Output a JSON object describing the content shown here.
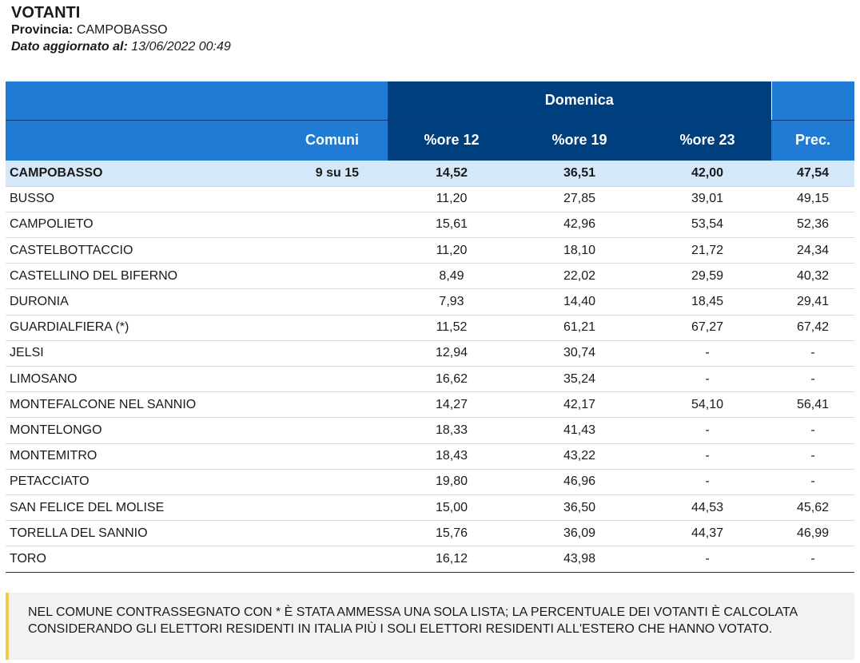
{
  "header": {
    "title": "VOTANTI",
    "provincia_label": "Provincia:",
    "provincia_value": "CAMPOBASSO",
    "updated_label": "Dato aggiornato al:",
    "updated_value": "13/06/2022 00:49"
  },
  "table": {
    "group_header": "Domenica",
    "columns": {
      "comuni": "Comuni",
      "p12": "%ore 12",
      "p19": "%ore 19",
      "p23": "%ore 23",
      "prec": "Prec."
    },
    "total": {
      "name": "CAMPOBASSO",
      "comuni": "9 su 15",
      "p12": "14,52",
      "p19": "36,51",
      "p23": "42,00",
      "prec": "47,54"
    },
    "rows": [
      {
        "name": "BUSSO",
        "p12": "11,20",
        "p19": "27,85",
        "p23": "39,01",
        "prec": "49,15"
      },
      {
        "name": "CAMPOLIETO",
        "p12": "15,61",
        "p19": "42,96",
        "p23": "53,54",
        "prec": "52,36"
      },
      {
        "name": "CASTELBOTTACCIO",
        "p12": "11,20",
        "p19": "18,10",
        "p23": "21,72",
        "prec": "24,34"
      },
      {
        "name": "CASTELLINO DEL BIFERNO",
        "p12": "8,49",
        "p19": "22,02",
        "p23": "29,59",
        "prec": "40,32"
      },
      {
        "name": "DURONIA",
        "p12": "7,93",
        "p19": "14,40",
        "p23": "18,45",
        "prec": "29,41"
      },
      {
        "name": "GUARDIALFIERA (*)",
        "p12": "11,52",
        "p19": "61,21",
        "p23": "67,27",
        "prec": "67,42"
      },
      {
        "name": "JELSI",
        "p12": "12,94",
        "p19": "30,74",
        "p23": "-",
        "prec": "-"
      },
      {
        "name": "LIMOSANO",
        "p12": "16,62",
        "p19": "35,24",
        "p23": "-",
        "prec": "-"
      },
      {
        "name": "MONTEFALCONE NEL SANNIO",
        "p12": "14,27",
        "p19": "42,17",
        "p23": "54,10",
        "prec": "56,41"
      },
      {
        "name": "MONTELONGO",
        "p12": "18,33",
        "p19": "41,43",
        "p23": "-",
        "prec": "-"
      },
      {
        "name": "MONTEMITRO",
        "p12": "18,43",
        "p19": "43,22",
        "p23": "-",
        "prec": "-"
      },
      {
        "name": "PETACCIATO",
        "p12": "19,80",
        "p19": "46,96",
        "p23": "-",
        "prec": "-"
      },
      {
        "name": "SAN FELICE DEL MOLISE",
        "p12": "15,00",
        "p19": "36,50",
        "p23": "44,53",
        "prec": "45,62"
      },
      {
        "name": "TORELLA DEL SANNIO",
        "p12": "15,76",
        "p19": "36,09",
        "p23": "44,37",
        "prec": "46,99"
      },
      {
        "name": "TORO",
        "p12": "16,12",
        "p19": "43,98",
        "p23": "-",
        "prec": "-"
      }
    ]
  },
  "note": {
    "text": "NEL COMUNE CONTRASSEGNATO CON * È STATA AMMESSA UNA SOLA LISTA; LA PERCENTUALE DEI VOTANTI È CALCOLATA CONSIDERANDO GLI ELETTORI RESIDENTI IN ITALIA PIÙ I SOLI ELETTORI RESIDENTI ALL'ESTERO CHE HANNO VOTATO."
  },
  "colors": {
    "header_blue": "#1f7bd3",
    "header_dark_blue": "#003f7e",
    "total_row_bg": "#d5e8fa",
    "note_accent": "#f2c94c"
  }
}
